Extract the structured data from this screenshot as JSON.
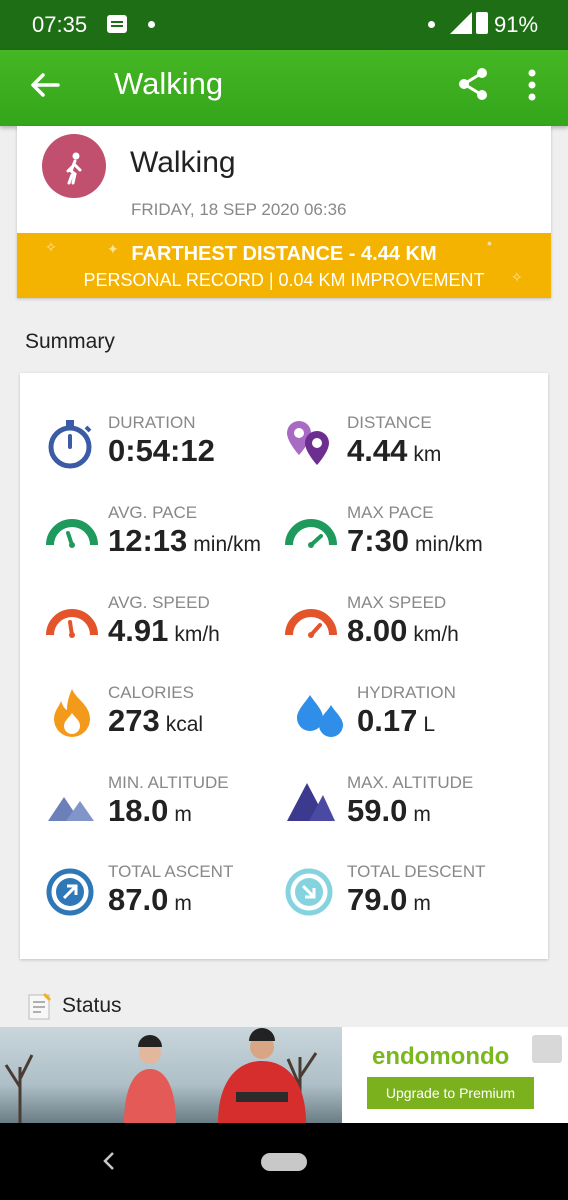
{
  "status_bar": {
    "time": "07:35",
    "battery": "91%"
  },
  "app_bar": {
    "title": "Walking"
  },
  "activity": {
    "title": "Walking",
    "date": "FRIDAY, 18 SEP 2020 06:36",
    "record_line1": "FARTHEST DISTANCE  -  4.44 KM",
    "record_line2": "PERSONAL RECORD  |  0.04 KM IMPROVEMENT"
  },
  "summary": {
    "heading": "Summary",
    "stats": [
      {
        "label": "DURATION",
        "value": "0:54:12",
        "unit": "",
        "icon": "stopwatch-icon"
      },
      {
        "label": "DISTANCE",
        "value": "4.44",
        "unit": "km",
        "icon": "location-pins-icon"
      },
      {
        "label": "AVG. PACE",
        "value": "12:13",
        "unit": "min/km",
        "icon": "gauge-green-icon"
      },
      {
        "label": "MAX PACE",
        "value": "7:30",
        "unit": "min/km",
        "icon": "gauge-green-icon"
      },
      {
        "label": "AVG. SPEED",
        "value": "4.91",
        "unit": "km/h",
        "icon": "gauge-orange-icon"
      },
      {
        "label": "MAX SPEED",
        "value": "8.00",
        "unit": "km/h",
        "icon": "gauge-orange-icon"
      },
      {
        "label": "CALORIES",
        "value": "273",
        "unit": "kcal",
        "icon": "flame-icon"
      },
      {
        "label": "HYDRATION",
        "value": "0.17",
        "unit": "L",
        "icon": "water-drops-icon"
      },
      {
        "label": "MIN. ALTITUDE",
        "value": "18.0",
        "unit": "m",
        "icon": "mountains-low-icon"
      },
      {
        "label": "MAX. ALTITUDE",
        "value": "59.0",
        "unit": "m",
        "icon": "mountains-high-icon"
      },
      {
        "label": "TOTAL ASCENT",
        "value": "87.0",
        "unit": "m",
        "icon": "ascent-arrow-icon"
      },
      {
        "label": "TOTAL DESCENT",
        "value": "79.0",
        "unit": "m",
        "icon": "descent-arrow-icon"
      }
    ]
  },
  "status_section": {
    "label": "Status"
  },
  "ad": {
    "brand": "endomondo",
    "cta": "Upgrade to Premium"
  },
  "colors": {
    "appbar": "#3aad1f",
    "statusbar": "#1e6e16",
    "record": "#f5b301",
    "avatar": "#c0506e"
  }
}
